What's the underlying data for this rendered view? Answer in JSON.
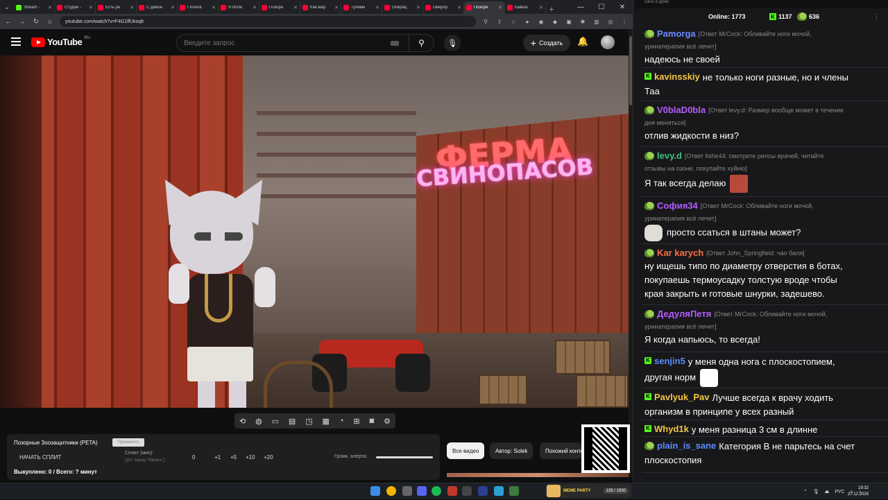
{
  "browser": {
    "tabs": [
      {
        "label": "Stream -",
        "color": "#53fc18",
        "active": false
      },
      {
        "label": "Студия -",
        "color": "#ff0033",
        "active": false
      },
      {
        "label": "Есть ре",
        "color": "#ff0033",
        "active": false
      },
      {
        "label": "С Девон",
        "color": "#ff0033",
        "active": false
      },
      {
        "label": "I Investi",
        "color": "#ff0033",
        "active": false
      },
      {
        "label": "Я посм",
        "color": "#ff0033",
        "active": false
      },
      {
        "label": "Позорн",
        "color": "#ff0033",
        "active": false
      },
      {
        "label": "Как мар",
        "color": "#ff0033",
        "active": false
      },
      {
        "label": "Тупемн",
        "color": "#ff0033",
        "active": false
      },
      {
        "label": "Операц",
        "color": "#ff0033",
        "active": false
      },
      {
        "label": "Оверлр",
        "color": "#ff0033",
        "active": false
      },
      {
        "label": "Позорн",
        "color": "#ff0033",
        "active": true
      },
      {
        "label": "Кавказ",
        "color": "#ff0033",
        "active": false
      }
    ],
    "url": "youtube.com/watch?v=F4G1ffUksq8"
  },
  "youtube": {
    "logo_text": "YouTube",
    "logo_region": "RU",
    "search_placeholder": "Введите запрос",
    "create_label": "Создать",
    "video_sign_top": "ФЕРМА",
    "video_sign_bottom": "СВИНОПАСОВ",
    "chips": {
      "all": "Все видео",
      "author": "Автор: Solek",
      "similar": "Похожий контент"
    }
  },
  "split_panel": {
    "title": "Позорные Зоозащитники (PETA)",
    "apply_label": "Применить",
    "start_label": "НАЧАТЬ СПЛИТ",
    "split_label": "Сплит (мин):",
    "split_hint": "(уст. перед \"Начать\")",
    "values": [
      "0",
      "+1",
      "+5",
      "+10",
      "+20"
    ],
    "volume_label": "Громк. алерта:",
    "bought_label": "Выкуплено: 0 / Всего: ? минут"
  },
  "overlay": {
    "meme_party_label": "MEME PARTY",
    "meme_party_count": "135 / 1500"
  },
  "taskbar": {
    "lang": "РУС",
    "time": "19:32",
    "date": "27.12.2025"
  },
  "chat": {
    "window_title": "Окно в дрию",
    "online_label": "Online:",
    "online_value": "1773",
    "kick_value": "1137",
    "coin_value": "636",
    "messages": [
      {
        "user": "Pamorga",
        "color": "#6a8cff",
        "badge": "pepe",
        "reply": "[Ответ MrCock: Обливайте ноги мочой,",
        "reply2": "уринатерапия всё лечит]",
        "text": "надеюсь не своей"
      },
      {
        "user": "kavinsskiy",
        "color": "#f5c542",
        "badge": "kick",
        "reply": "",
        "reply2": "",
        "text": "не только ноги разные, но и члены",
        "text2": "Таа"
      },
      {
        "user": "V0blaD0bla",
        "color": "#b35cff",
        "badge": "pepe",
        "reply": "[Ответ levy.d: Размер вообще может в течении",
        "reply2": "дня меняться]",
        "text": "отлив жидкости в низ?"
      },
      {
        "user": "levy.d",
        "color": "#3fbf7f",
        "badge": "pepe",
        "reply": "[Ответ fishe44: смотрите рилсы врачей, читайте",
        "reply2": "отзывы на озоне, покупайте хуйню]",
        "text": "Я так всегда делаю"
      },
      {
        "user": "София34",
        "color": "#b35cff",
        "badge": "pepe",
        "reply": "[Ответ MrCock: Обливайте ноги мочой,",
        "reply2": "уринатерапия всё лечит]",
        "text": "просто ссаться в штаны может?"
      },
      {
        "user": "Kar karych",
        "color": "#ff7043",
        "badge": "pepe",
        "reply": "[Ответ John_Springfield: чао баля]",
        "reply2": "",
        "text": "ну ищешь типо по диаметру отверстия в ботах,",
        "text2": "покупаешь термоусадку толстую вроде чтобы",
        "text3": "края закрыть и готовые шнурки, задешево."
      },
      {
        "user": "ДедуляПетя",
        "color": "#b35cff",
        "badge": "pepe",
        "reply": "[Ответ MrCock: Обливайте ноги мочой,",
        "reply2": "уринатерапия всё лечит]",
        "text": "Я когда напьюсь, то всегда!"
      },
      {
        "user": "senjin5",
        "color": "#5b8cff",
        "badge": "kick",
        "reply": "",
        "reply2": "",
        "text": "у меня одна нога с плоскостопием,",
        "text2": "другая норм"
      },
      {
        "user": "Pavlyuk_Pav",
        "color": "#f5c542",
        "badge": "kick",
        "reply": "",
        "reply2": "",
        "text": "Лучше всегда к врачу ходить",
        "text2": "организм в принципе у всех разный"
      },
      {
        "user": "Whyd1k",
        "color": "#f5c542",
        "badge": "kick",
        "reply": "",
        "reply2": "",
        "text": "у меня разница 3 см в длинне"
      },
      {
        "user": "plain_is_sane",
        "color": "#5b8cff",
        "badge": "pepe",
        "reply": "",
        "reply2": "",
        "text": "Категория В не парьтесь на счет",
        "text2": "плоскостопия"
      }
    ]
  }
}
